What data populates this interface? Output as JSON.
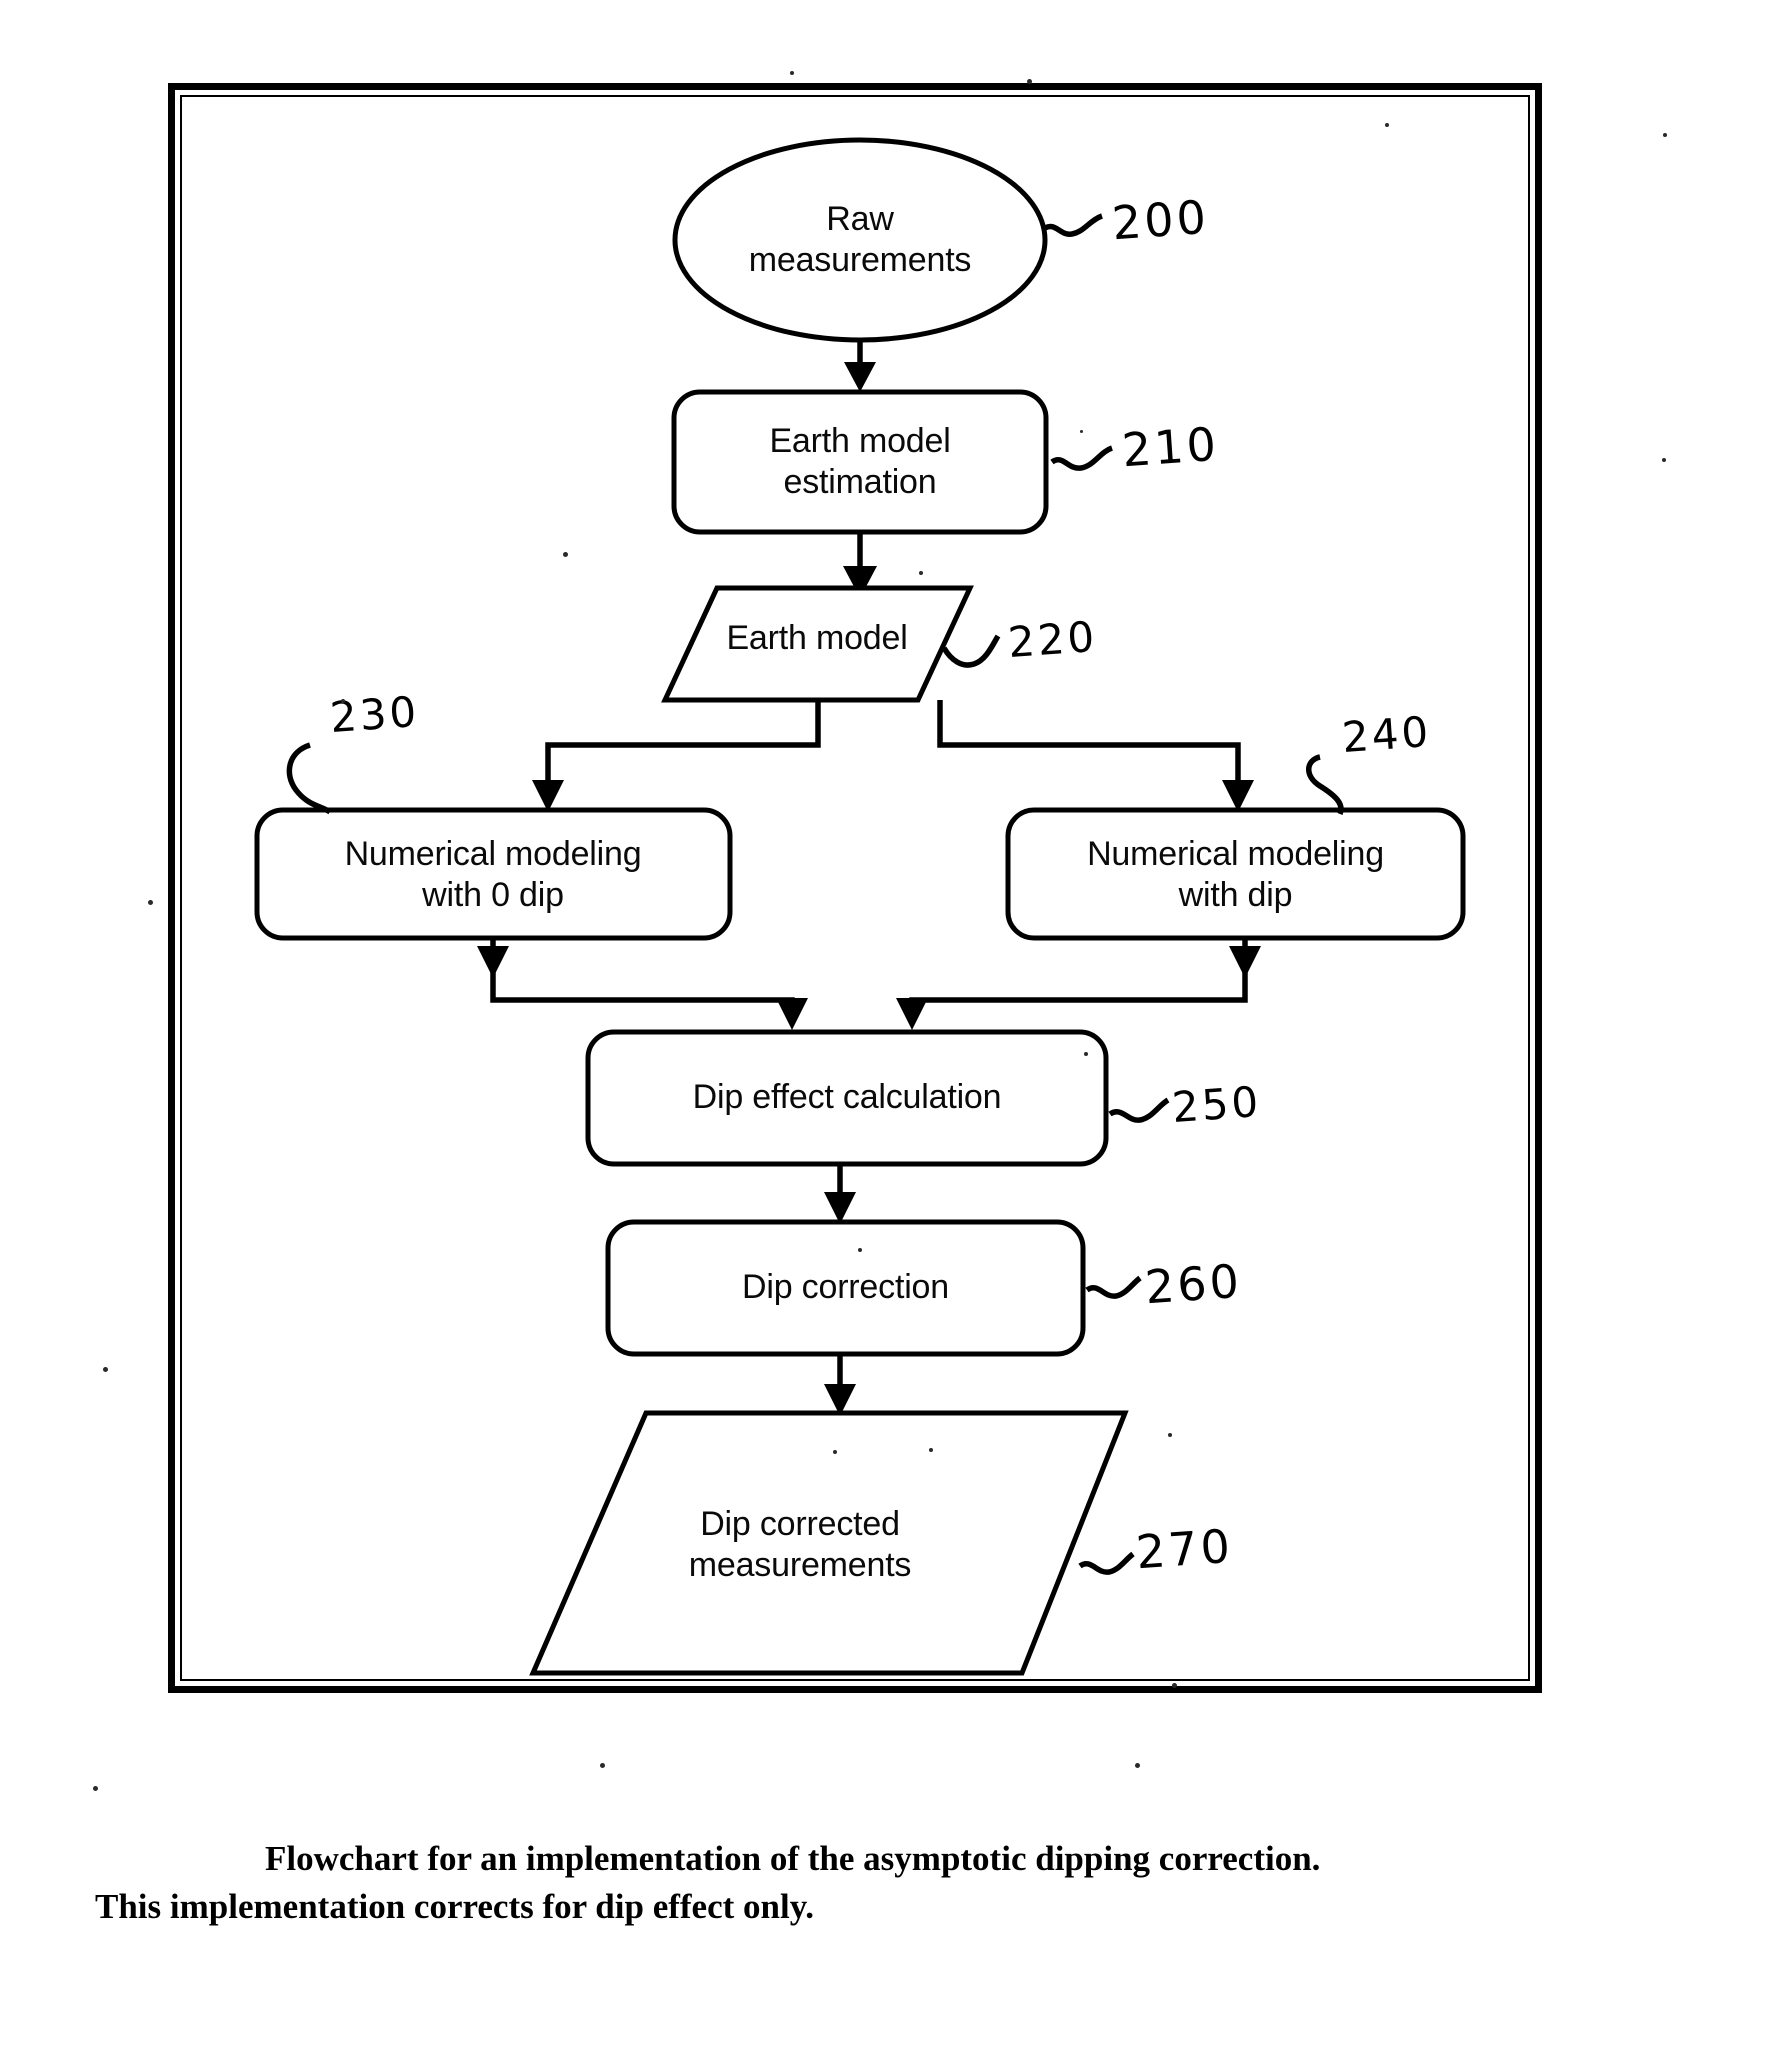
{
  "figure": {
    "type": "flowchart",
    "caption_line_1": "Flowchart for an implementation of the asymptotic dipping correction.",
    "caption_line_2": "This implementation corrects for dip effect only.",
    "border_color": "#000000",
    "text_color": "#0a0a0a"
  },
  "nodes": [
    {
      "id": "raw-measurements",
      "shape": "ellipse",
      "label": "Raw\nmeasurements",
      "label_line_1": "Raw",
      "label_line_2": "measurements",
      "ref": "200"
    },
    {
      "id": "earth-model-estimation",
      "shape": "rounded-rect",
      "label": "Earth model\nestimation",
      "label_line_1": "Earth model",
      "label_line_2": "estimation",
      "ref": "210"
    },
    {
      "id": "earth-model",
      "shape": "parallelogram",
      "label": "Earth model",
      "ref": "220"
    },
    {
      "id": "numerical-modeling-zero-dip",
      "shape": "rounded-rect",
      "label": "Numerical modeling\nwith 0 dip",
      "label_line_1": "Numerical modeling",
      "label_line_2": "with 0 dip",
      "ref": "230"
    },
    {
      "id": "numerical-modeling-with-dip",
      "shape": "rounded-rect",
      "label": "Numerical modeling\nwith dip",
      "label_line_1": "Numerical modeling",
      "label_line_2": "with dip",
      "ref": "240"
    },
    {
      "id": "dip-effect-calculation",
      "shape": "rounded-rect",
      "label": "Dip effect calculation",
      "ref": "250"
    },
    {
      "id": "dip-correction",
      "shape": "rounded-rect",
      "label": "Dip correction",
      "ref": "260"
    },
    {
      "id": "dip-corrected-measurements",
      "shape": "parallelogram",
      "label": "Dip corrected\nmeasurements",
      "label_line_1": "Dip corrected",
      "label_line_2": "measurements",
      "ref": "270"
    }
  ],
  "edges": [
    {
      "from": "raw-measurements",
      "to": "earth-model-estimation"
    },
    {
      "from": "earth-model-estimation",
      "to": "earth-model"
    },
    {
      "from": "earth-model",
      "to": "numerical-modeling-zero-dip"
    },
    {
      "from": "earth-model",
      "to": "numerical-modeling-with-dip"
    },
    {
      "from": "numerical-modeling-zero-dip",
      "to": "dip-effect-calculation"
    },
    {
      "from": "numerical-modeling-with-dip",
      "to": "dip-effect-calculation"
    },
    {
      "from": "dip-effect-calculation",
      "to": "dip-correction"
    },
    {
      "from": "dip-correction",
      "to": "dip-corrected-measurements"
    }
  ]
}
